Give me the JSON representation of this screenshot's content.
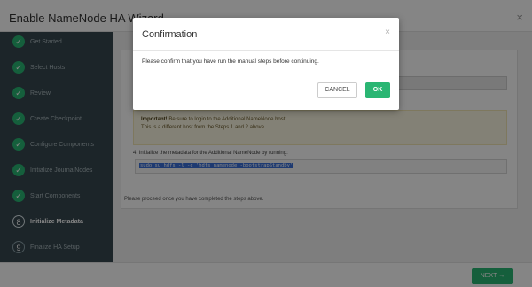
{
  "wizard": {
    "title": "Enable NameNode HA Wizard",
    "close_glyph": "×",
    "steps": [
      {
        "number": "✓",
        "label": "Get Started",
        "status": "done"
      },
      {
        "number": "✓",
        "label": "Select Hosts",
        "status": "done"
      },
      {
        "number": "✓",
        "label": "Review",
        "status": "done"
      },
      {
        "number": "✓",
        "label": "Create Checkpoint",
        "status": "done"
      },
      {
        "number": "✓",
        "label": "Configure Components",
        "status": "done"
      },
      {
        "number": "✓",
        "label": "Initialize JournalNodes",
        "status": "done"
      },
      {
        "number": "✓",
        "label": "Start Components",
        "status": "done"
      },
      {
        "number": "8",
        "label": "Initialize Metadata",
        "status": "current"
      },
      {
        "number": "9",
        "label": "Finalize HA Setup",
        "status": "pending"
      }
    ],
    "alert": {
      "strong": "Important!",
      "text": " Be sure to login to the Additional NameNode host.",
      "line2": "This is a different host from the Steps 1 and 2 above."
    },
    "step4_text": "4. Initialize the metadata for the Additional NameNode by running:",
    "command": "sudo su hdfs -l -c 'hdfs namenode -bootstrapStandby'",
    "proceed_text": "Please proceed once you have completed the steps above.",
    "next_label": "NEXT →"
  },
  "modal": {
    "title": "Confirmation",
    "close_glyph": "×",
    "body": "Please confirm that you have run the manual steps before continuing.",
    "cancel_label": "CANCEL",
    "ok_label": "OK"
  },
  "colors": {
    "accent": "#2ab673",
    "sidebar": "#36474f",
    "selection": "#3a6fd8"
  }
}
